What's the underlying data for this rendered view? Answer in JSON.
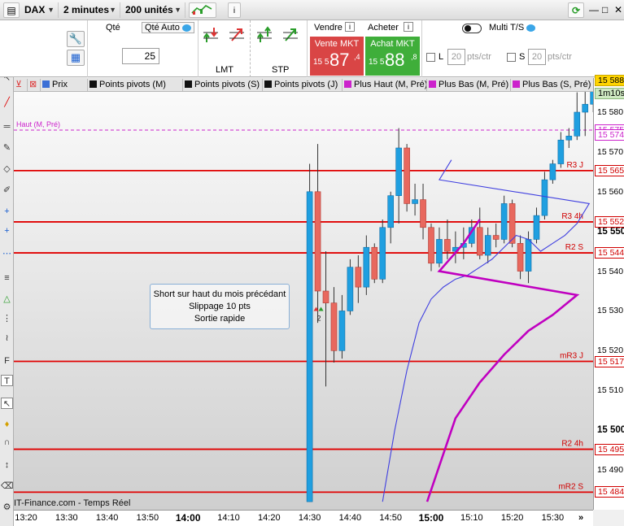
{
  "toolbar": {
    "instrument": "DAX",
    "timeframe": "2 minutes",
    "units": "200 unités",
    "info_icon": "info-icon",
    "refresh_icon": "refresh-icon"
  },
  "window_controls": {
    "minimize": "—",
    "restore": "□",
    "close": "✕"
  },
  "order_panel": {
    "qty_label": "Qté",
    "qty_auto_label": "Qté Auto",
    "qty_value": "25",
    "lmt_label": "LMT",
    "stp_label": "STP",
    "vendre_label": "Vendre",
    "acheter_label": "Acheter",
    "sell": {
      "label": "Vente MKT",
      "prefix": "15 5",
      "big": "87",
      "sup": ",4"
    },
    "buy": {
      "label": "Achat MKT",
      "prefix": "15 5",
      "big": "88",
      "sup": ",8"
    },
    "multi_label": "Multi T/S",
    "limit": {
      "letter": "L",
      "value": "20",
      "unit": "pts/ctr"
    },
    "stop": {
      "letter": "S",
      "value": "20",
      "unit": "pts/ctr"
    }
  },
  "indicators": [
    {
      "label": "Prix",
      "color": "#3b6fd6"
    },
    {
      "label": "Points pivots (M)",
      "color": "#111111"
    },
    {
      "label": "Points pivots (S)",
      "color": "#111111"
    },
    {
      "label": "Points pivots (J)",
      "color": "#111111"
    },
    {
      "label": "Plus Haut (M, Pré)",
      "color": "#cc22cc"
    },
    {
      "label": "Plus Bas (M, Pré)",
      "color": "#cc22cc"
    },
    {
      "label": "Plus Bas (S, Pré)",
      "color": "#cc22cc"
    }
  ],
  "colors": {
    "pivot_red": "#e00000",
    "up_candle": "#1f9fe0",
    "down_candle": "#e8685e",
    "ma_fast": "#4040e0",
    "ma_slow": "#c000c0",
    "high_line": "#cc22cc"
  },
  "chart_data": {
    "type": "candlestick",
    "x_labels": [
      "13:20",
      "13:30",
      "13:40",
      "13:50",
      "14:00",
      "14:10",
      "14:20",
      "14:30",
      "14:40",
      "14:50",
      "15:00",
      "15:10",
      "15:20",
      "15:30"
    ],
    "bold_x_labels": [
      "14:00",
      "15:00"
    ],
    "ylim": [
      15482,
      15590
    ],
    "y_ticks": [
      15580,
      15570,
      15560,
      15550,
      15540,
      15530,
      15520,
      15510,
      15500,
      15490
    ],
    "bold_y_ticks": [
      15550,
      15500
    ],
    "levels": [
      {
        "name": "Haut (M, Pré)",
        "value": 15575.5,
        "tag": "15 575,",
        "style": "dashed",
        "color": "#cc22cc"
      },
      {
        "name": "R3 J",
        "value": 15565.3,
        "tag": "15 565,",
        "style": "solid",
        "color": "#e00000"
      },
      {
        "name": "R3 4h",
        "value": 15552.4,
        "tag": "15 552,",
        "style": "solid",
        "color": "#e00000"
      },
      {
        "name": "R2 S",
        "value": 15544.6,
        "tag": "15 544,",
        "style": "solid",
        "color": "#e00000"
      },
      {
        "name": "mR3 J",
        "value": 15517.3,
        "tag": "15 517,",
        "style": "solid",
        "color": "#e00000"
      },
      {
        "name": "R2 4h",
        "value": 15495.2,
        "tag": "15 495,",
        "style": "solid",
        "color": "#e00000"
      },
      {
        "name": "mR2 S",
        "value": 15484.4,
        "tag": "15 484,",
        "style": "solid",
        "color": "#e00000"
      }
    ],
    "extra_tags": [
      {
        "value": 15588.0,
        "tag": "15 588,",
        "kind": "cur"
      },
      {
        "value": 15574.2,
        "tag": "15 574,",
        "kind": "plain"
      }
    ],
    "countdown": "1m10s",
    "candles_t": [
      14.3,
      14.33,
      14.36,
      14.39,
      14.42,
      14.45,
      14.48,
      14.51,
      14.54,
      14.57,
      14.6,
      14.63,
      14.66,
      14.69,
      14.72,
      14.75,
      14.78,
      14.81,
      14.84,
      14.87,
      14.9,
      14.93,
      14.96,
      14.99,
      15.02,
      15.05,
      15.08,
      15.11,
      15.14,
      15.17,
      15.2,
      15.23,
      15.26,
      15.29,
      15.32,
      15.35,
      15.38,
      15.41
    ],
    "candles": [
      {
        "t": "14:30",
        "o": 15482,
        "h": 15567,
        "l": 15482,
        "c": 15560
      },
      {
        "t": "14:32",
        "o": 15560,
        "h": 15572,
        "l": 15527,
        "c": 15535
      },
      {
        "t": "14:34",
        "o": 15535,
        "h": 15545,
        "l": 15511,
        "c": 15532
      },
      {
        "t": "14:36",
        "o": 15532,
        "h": 15536,
        "l": 15517,
        "c": 15520
      },
      {
        "t": "14:38",
        "o": 15520,
        "h": 15534,
        "l": 15518,
        "c": 15530
      },
      {
        "t": "14:40",
        "o": 15530,
        "h": 15543,
        "l": 15529,
        "c": 15541
      },
      {
        "t": "14:42",
        "o": 15541,
        "h": 15544,
        "l": 15532,
        "c": 15536
      },
      {
        "t": "14:44",
        "o": 15536,
        "h": 15549,
        "l": 15534,
        "c": 15546
      },
      {
        "t": "14:46",
        "o": 15546,
        "h": 15547,
        "l": 15537,
        "c": 15538
      },
      {
        "t": "14:48",
        "o": 15538,
        "h": 15553,
        "l": 15537,
        "c": 15551
      },
      {
        "t": "14:50",
        "o": 15551,
        "h": 15560,
        "l": 15547,
        "c": 15559
      },
      {
        "t": "14:52",
        "o": 15559,
        "h": 15576,
        "l": 15552,
        "c": 15571
      },
      {
        "t": "14:54",
        "o": 15571,
        "h": 15572,
        "l": 15555,
        "c": 15557
      },
      {
        "t": "14:56",
        "o": 15557,
        "h": 15562,
        "l": 15554,
        "c": 15558
      },
      {
        "t": "14:58",
        "o": 15558,
        "h": 15562,
        "l": 15548,
        "c": 15551
      },
      {
        "t": "15:00",
        "o": 15551,
        "h": 15552,
        "l": 15540,
        "c": 15542
      },
      {
        "t": "15:02",
        "o": 15542,
        "h": 15551,
        "l": 15541,
        "c": 15548
      },
      {
        "t": "15:04",
        "o": 15548,
        "h": 15553,
        "l": 15543,
        "c": 15545
      },
      {
        "t": "15:06",
        "o": 15545,
        "h": 15550,
        "l": 15542,
        "c": 15546
      },
      {
        "t": "15:08",
        "o": 15546,
        "h": 15551,
        "l": 15543,
        "c": 15547
      },
      {
        "t": "15:10",
        "o": 15547,
        "h": 15553,
        "l": 15546,
        "c": 15551
      },
      {
        "t": "15:12",
        "o": 15551,
        "h": 15556,
        "l": 15543,
        "c": 15544
      },
      {
        "t": "15:14",
        "o": 15544,
        "h": 15551,
        "l": 15542,
        "c": 15549
      },
      {
        "t": "15:16",
        "o": 15549,
        "h": 15552,
        "l": 15546,
        "c": 15548
      },
      {
        "t": "15:18",
        "o": 15548,
        "h": 15559,
        "l": 15547,
        "c": 15557
      },
      {
        "t": "15:20",
        "o": 15557,
        "h": 15558,
        "l": 15546,
        "c": 15547
      },
      {
        "t": "15:22",
        "o": 15547,
        "h": 15549,
        "l": 15538,
        "c": 15540
      },
      {
        "t": "15:24",
        "o": 15540,
        "h": 15550,
        "l": 15537,
        "c": 15548
      },
      {
        "t": "15:26",
        "o": 15548,
        "h": 15556,
        "l": 15547,
        "c": 15554
      },
      {
        "t": "15:28",
        "o": 15554,
        "h": 15565,
        "l": 15553,
        "c": 15563
      },
      {
        "t": "15:30",
        "o": 15563,
        "h": 15568,
        "l": 15562,
        "c": 15567
      },
      {
        "t": "15:32",
        "o": 15567,
        "h": 15575,
        "l": 15566,
        "c": 15573
      },
      {
        "t": "15:34",
        "o": 15573,
        "h": 15576,
        "l": 15571,
        "c": 15574
      },
      {
        "t": "15:36",
        "o": 15574,
        "h": 15585,
        "l": 15573,
        "c": 15580
      },
      {
        "t": "15:38",
        "o": 15580,
        "h": 15587,
        "l": 15574,
        "c": 15582
      },
      {
        "t": "15:40",
        "o": 15582,
        "h": 15590,
        "l": 15580,
        "c": 15588
      }
    ],
    "ma_fast": [
      [
        14.48,
        15482
      ],
      [
        14.51,
        15500
      ],
      [
        14.54,
        15515
      ],
      [
        14.57,
        15527
      ],
      [
        14.6,
        15533
      ],
      [
        14.63,
        15536
      ],
      [
        14.66,
        15538
      ],
      [
        14.69,
        15539
      ],
      [
        14.72,
        15541
      ],
      [
        14.75,
        15543
      ],
      [
        14.78,
        15546
      ],
      [
        14.81,
        15549
      ],
      [
        14.84,
        15548
      ],
      [
        14.87,
        15545
      ],
      [
        14.9,
        15547
      ],
      [
        14.93,
        15549
      ],
      [
        14.96,
        15552
      ],
      [
        14.99,
        15557
      ],
      [
        15.02,
        15563
      ],
      [
        15.05,
        15568
      ]
    ],
    "ma_slow": [
      [
        14.59,
        15482
      ],
      [
        14.66,
        15503
      ],
      [
        14.72,
        15512
      ],
      [
        14.78,
        15519
      ],
      [
        14.84,
        15525
      ],
      [
        14.9,
        15529
      ],
      [
        14.96,
        15534
      ],
      [
        15.02,
        15540
      ],
      [
        15.08,
        15547
      ],
      [
        15.12,
        15553
      ]
    ],
    "annotation": {
      "lines": [
        "Short sur haut du mois précédant",
        "Slippage 10 pts",
        "Sortie rapide"
      ]
    },
    "marker_label": "2",
    "watermark": "IT-Finance.com - Temps Réel"
  }
}
